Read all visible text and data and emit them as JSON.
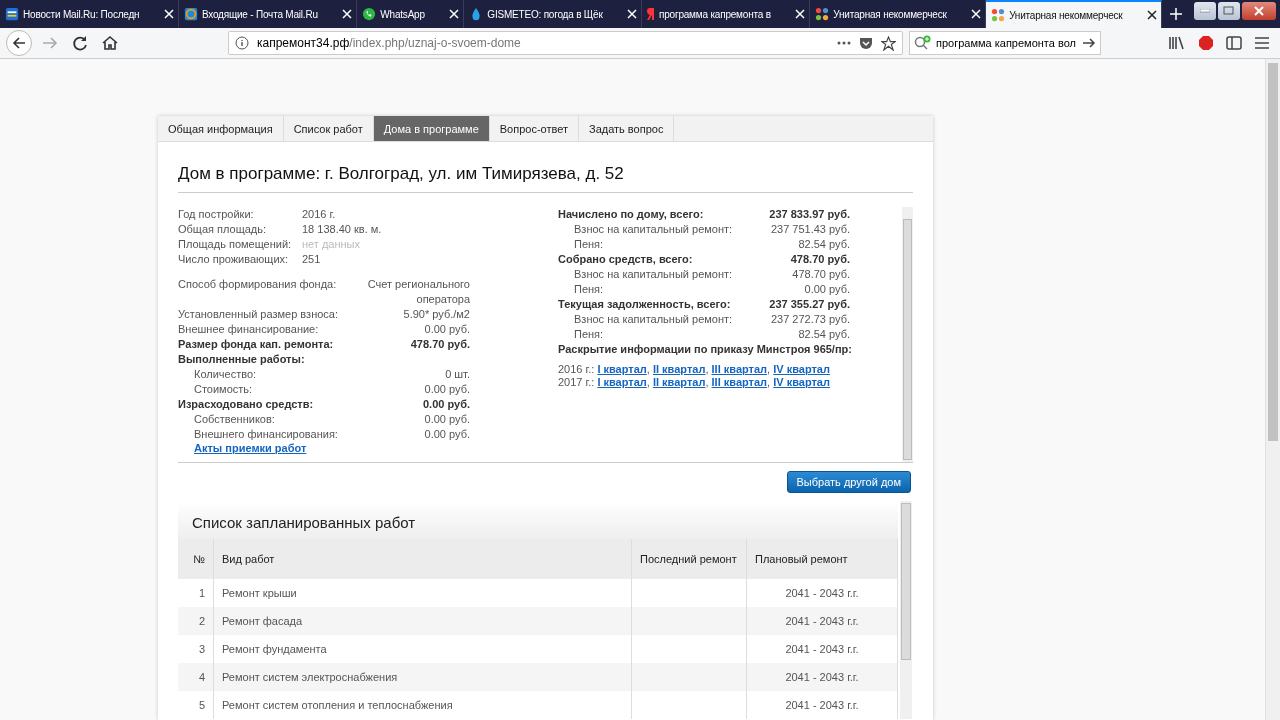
{
  "browser": {
    "tabs": [
      {
        "title": "Новости Mail.Ru: Последн",
        "selected": false
      },
      {
        "title": "Входящие - Почта Mail.Ru",
        "selected": false
      },
      {
        "title": "WhatsApp",
        "selected": false
      },
      {
        "title": "GISMETEO: погода в Щёк",
        "selected": false
      },
      {
        "title": "программа капремонта в",
        "selected": false
      },
      {
        "title": "Унитарная некоммерческ",
        "selected": false
      },
      {
        "title": "Унитарная некоммерческ",
        "selected": true
      }
    ],
    "url": {
      "domain": "капремонт34.рф",
      "path": "/index.php/uznaj-o-svoem-dome"
    },
    "search": {
      "value": "программа капремонта вол"
    }
  },
  "site_tabs": [
    {
      "label": "Общая информация",
      "selected": false
    },
    {
      "label": "Список работ",
      "selected": false
    },
    {
      "label": "Дома в программе",
      "selected": true
    },
    {
      "label": "Вопрос-ответ",
      "selected": false
    },
    {
      "label": "Задать вопрос",
      "selected": false
    }
  ],
  "heading": "Дом в программе: г. Волгоград, ул. им Тимирязева, д. 52",
  "house_facts": [
    {
      "label": "Год постройки:",
      "value": "2016 г.",
      "muted": false
    },
    {
      "label": "Общая площадь:",
      "value": "18 138.40 кв. м.",
      "muted": false
    },
    {
      "label": "Площадь помещений:",
      "value": "нет данных",
      "muted": true
    },
    {
      "label": "Число проживающих:",
      "value": "251",
      "muted": false
    }
  ],
  "fund_rows": [
    {
      "label": "Способ формирования фонда:",
      "value": "Счет регионального оператора",
      "kind": "normal"
    },
    {
      "label": "Установленный размер взноса:",
      "value": "5.90* руб./м2",
      "kind": "normal"
    },
    {
      "label": "Внешнее финансирование:",
      "value": "0.00 руб.",
      "kind": "normal"
    },
    {
      "label": "Размер фонда кап. ремонта:",
      "value": "478.70 руб.",
      "kind": "total"
    },
    {
      "label": "Выполненные работы:",
      "kind": "total"
    },
    {
      "label": "Количество:",
      "value": "0 шт.",
      "kind": "sub"
    },
    {
      "label": "Стоимость:",
      "value": "0.00 руб.",
      "kind": "sub"
    },
    {
      "label": "Израсходовано средств:",
      "value": "0.00 руб.",
      "kind": "total"
    },
    {
      "label": "Собственников:",
      "value": "0.00 руб.",
      "kind": "sub"
    },
    {
      "label": "Внешнего финансирования:",
      "value": "0.00 руб.",
      "kind": "sub"
    }
  ],
  "acts_link": "Акты приемки работ",
  "payment_rows": [
    {
      "label": "Начислено по дому, всего:",
      "value": "237 833.97 руб.",
      "kind": "total"
    },
    {
      "label": "Взнос на капитальный ремонт:",
      "value": "237 751.43 руб.",
      "kind": "sub"
    },
    {
      "label": "Пеня:",
      "value": "82.54 руб.",
      "kind": "sub"
    },
    {
      "label": "Собрано средств, всего:",
      "value": "478.70 руб.",
      "kind": "total"
    },
    {
      "label": "Взнос на капитальный ремонт:",
      "value": "478.70 руб.",
      "kind": "sub"
    },
    {
      "label": "Пеня:",
      "value": "0.00 руб.",
      "kind": "sub"
    },
    {
      "label": "Текущая задолженность, всего:",
      "value": "237 355.27 руб.",
      "kind": "total"
    },
    {
      "label": "Взнос на капитальный ремонт:",
      "value": "237 272.73 руб.",
      "kind": "sub"
    },
    {
      "label": "Пеня:",
      "value": "82.54 руб.",
      "kind": "sub"
    }
  ],
  "disclosure": {
    "title": "Раскрытие информации по приказу Минстроя 965/пр:",
    "separator": ",",
    "years": [
      {
        "year": "2016 г.:",
        "links": [
          "I квартал",
          "II квартал",
          "III квартал",
          "IV квартал"
        ]
      },
      {
        "year": "2017 г.:",
        "links": [
          "I квартал",
          "II квартал",
          "III квартал",
          "IV квартал"
        ]
      }
    ]
  },
  "choose_button": "Выбрать другой дом",
  "works": {
    "title": "Список запланированных работ",
    "columns": [
      "№",
      "Вид работ",
      "Последний ремонт",
      "Плановый ремонт"
    ],
    "rows": [
      [
        "1",
        "Ремонт крыши",
        "",
        "2041 - 2043 г.г."
      ],
      [
        "2",
        "Ремонт фасада",
        "",
        "2041 - 2043 г.г."
      ],
      [
        "3",
        "Ремонт фундамента",
        "",
        "2041 - 2043 г.г."
      ],
      [
        "4",
        "Ремонт систем электроснабжения",
        "",
        "2041 - 2043 г.г."
      ],
      [
        "5",
        "Ремонт систем отопления и теплоснабжения",
        "",
        "2041 - 2043 г.г."
      ]
    ]
  }
}
